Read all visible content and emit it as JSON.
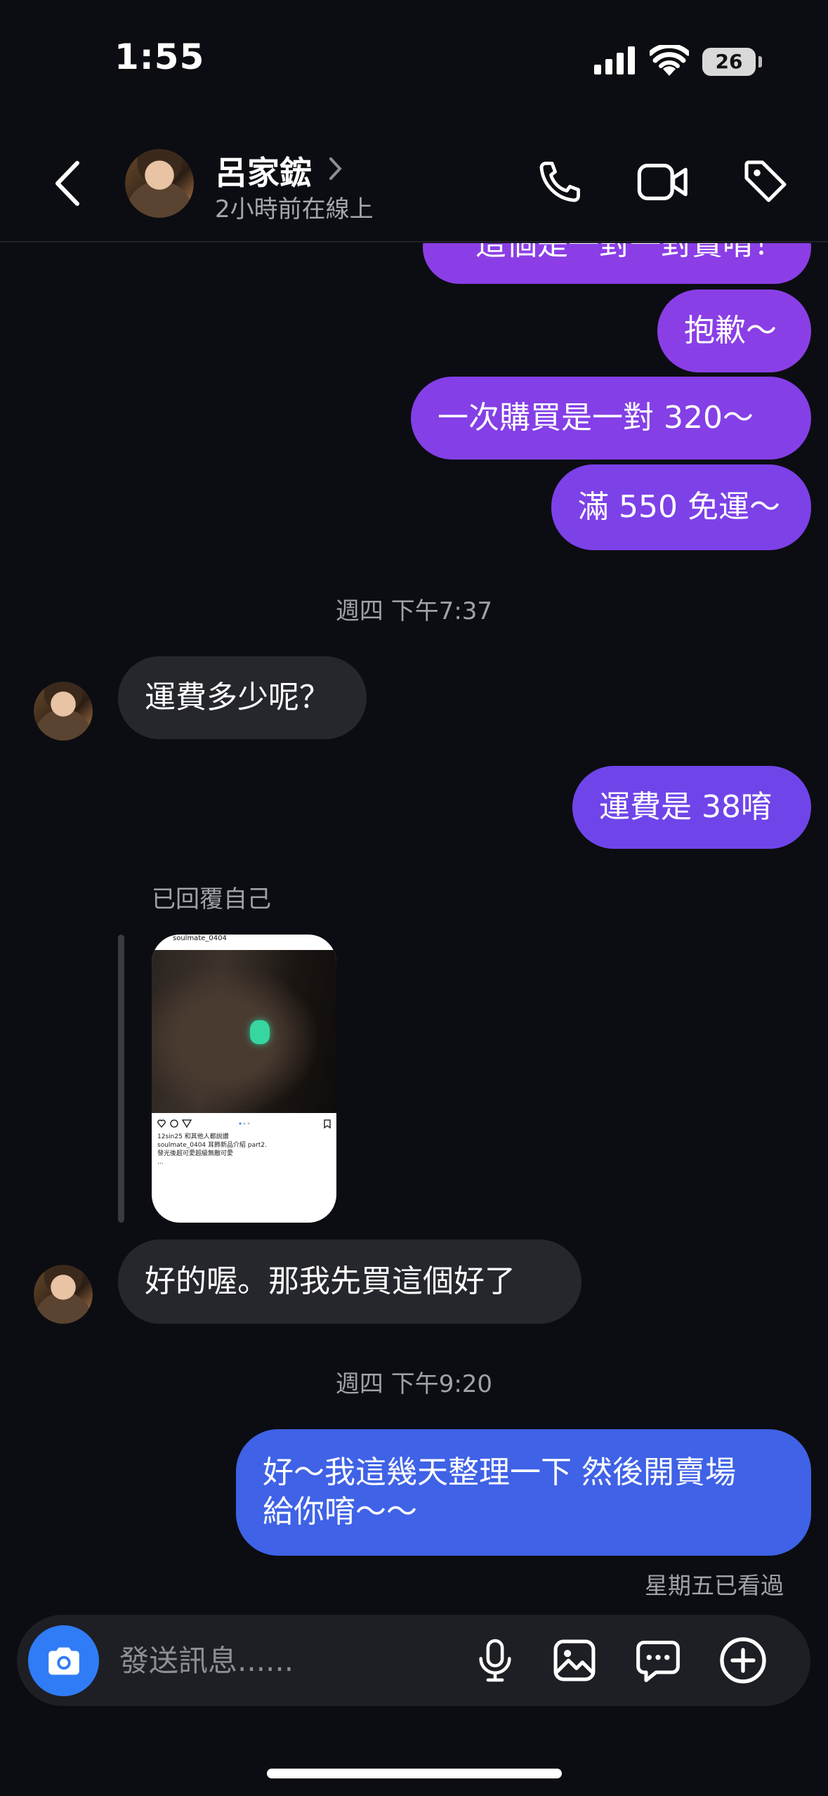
{
  "status_bar": {
    "time": "1:55",
    "battery": "26"
  },
  "header": {
    "contact_name": "呂家鋐",
    "contact_status": "2小時前在線上"
  },
  "messages": [
    {
      "id": "m0",
      "from": "me",
      "text": "這個是一對一對賣唷！"
    },
    {
      "id": "m1",
      "from": "me",
      "text": "抱歉～"
    },
    {
      "id": "m2",
      "from": "me",
      "text": "一次購買是一對 320～"
    },
    {
      "id": "m3",
      "from": "me",
      "text": "滿 550 免運～"
    },
    {
      "id": "t1",
      "type": "timestamp",
      "text": "週四 下午7:37"
    },
    {
      "id": "m4",
      "from": "them",
      "text": "運費多少呢？"
    },
    {
      "id": "m5",
      "from": "me",
      "text": "運費是 38唷"
    },
    {
      "id": "m6",
      "from": "them",
      "type": "shared_post",
      "label": "已回覆自己",
      "post_user": "soulmate_0404",
      "post_caption": "12sin25 和其他人都說讚\nsoulmate_0404 耳飾新品介紹 part2.\n發光後超可愛超級無敵可愛\n..."
    },
    {
      "id": "m7",
      "from": "them",
      "text": "好的喔。那我先買這個好了"
    },
    {
      "id": "t2",
      "type": "timestamp",
      "text": "週四 下午9:20"
    },
    {
      "id": "m8",
      "from": "me",
      "text_line1": "好～我這幾天整理一下 然後開賣場",
      "text_line2": "給你唷～～"
    }
  ],
  "seen_status": "星期五已看過",
  "composer": {
    "placeholder": "發送訊息......"
  },
  "colors": {
    "background": "#0c0d12",
    "bubble_purple": "#8b3ee6",
    "bubble_violet": "#6f45ea",
    "bubble_blue": "#3f62e6",
    "bubble_incoming": "#26272d",
    "camera_button": "#2f7cf6"
  },
  "icons": [
    "back-chevron-icon",
    "phone-icon",
    "video-call-icon",
    "tag-icon",
    "camera-icon",
    "microphone-icon",
    "gallery-icon",
    "sticker-chat-icon",
    "plus-circle-icon"
  ]
}
